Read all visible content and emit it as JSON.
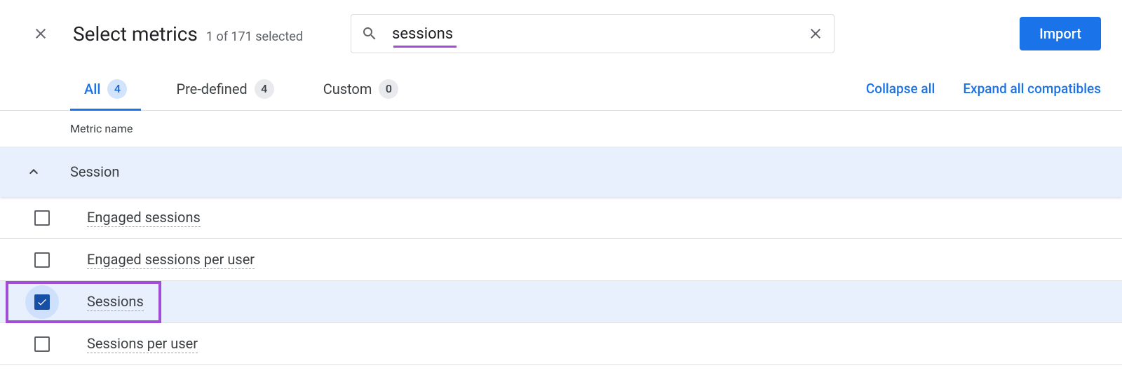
{
  "header": {
    "title": "Select metrics",
    "selection_text": "1 of 171 selected",
    "search_value": "sessions",
    "import_label": "Import"
  },
  "tabs": {
    "items": [
      {
        "label": "All",
        "count": "4",
        "active": true
      },
      {
        "label": "Pre-defined",
        "count": "4",
        "active": false
      },
      {
        "label": "Custom",
        "count": "0",
        "active": false
      }
    ],
    "collapse_label": "Collapse all",
    "expand_label": "Expand all compatibles"
  },
  "table": {
    "column_header": "Metric name",
    "group_title": "Session",
    "rows": [
      {
        "label": "Engaged sessions",
        "checked": false
      },
      {
        "label": "Engaged sessions per user",
        "checked": false
      },
      {
        "label": "Sessions",
        "checked": true
      },
      {
        "label": "Sessions per user",
        "checked": false
      }
    ]
  }
}
